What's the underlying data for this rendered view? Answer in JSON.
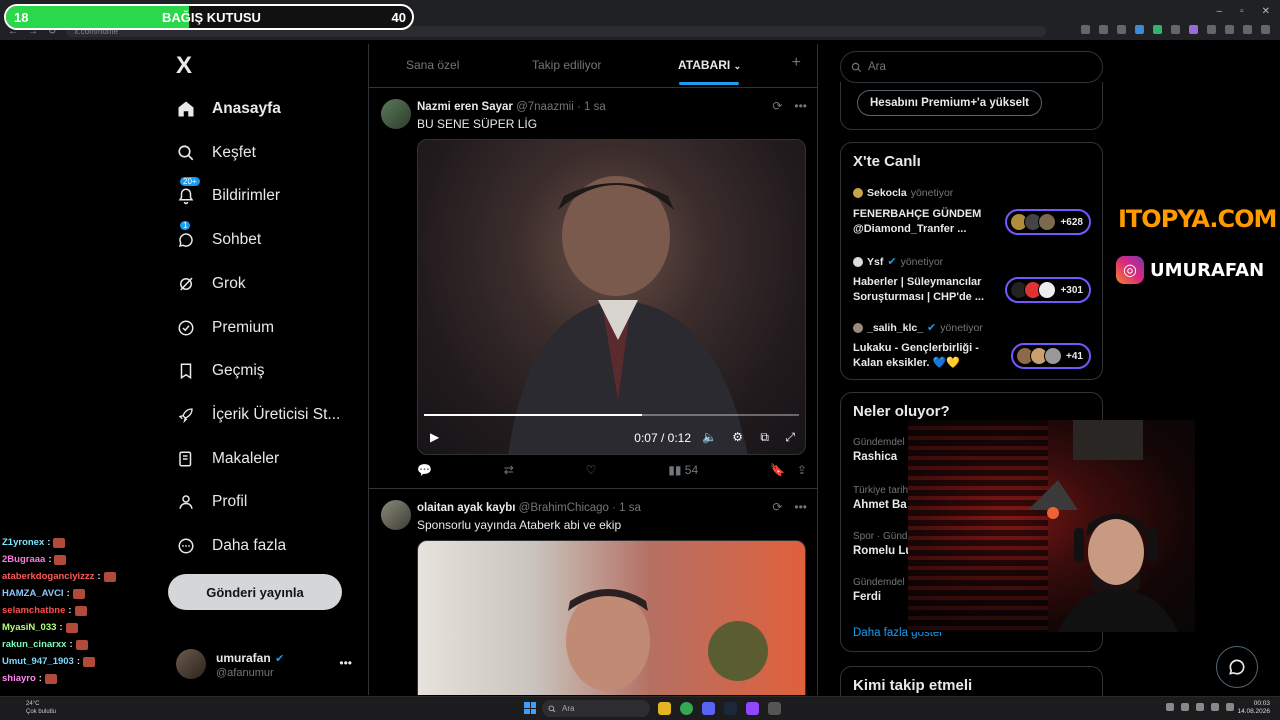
{
  "browser": {
    "url": "x.com/home"
  },
  "donation": {
    "left_value": "18",
    "label": "BAĞIŞ KUTUSU",
    "right_value": "40",
    "progress": 0.45,
    "color": "#2bd84b"
  },
  "sidebar": {
    "logo": "X",
    "items": [
      {
        "label": "Anasayfa",
        "icon": "home-icon"
      },
      {
        "label": "Keşfet",
        "icon": "search-icon"
      },
      {
        "label": "Bildirimler",
        "icon": "bell-icon",
        "badge": "20+"
      },
      {
        "label": "Sohbet",
        "icon": "chat-icon",
        "badge": "1"
      },
      {
        "label": "Grok",
        "icon": "grok-icon"
      },
      {
        "label": "Premium",
        "icon": "premium-icon"
      },
      {
        "label": "Geçmiş",
        "icon": "bookmark-icon"
      },
      {
        "label": "İçerik Üreticisi St...",
        "icon": "rocket-icon"
      },
      {
        "label": "Makaleler",
        "icon": "articles-icon"
      },
      {
        "label": "Profil",
        "icon": "profile-icon"
      },
      {
        "label": "Daha fazla",
        "icon": "more-icon"
      }
    ],
    "post_button": "Gönderi yayınla",
    "user": {
      "name": "umurafan",
      "handle": "@afanumur"
    }
  },
  "tabs": [
    {
      "label": "Sana özel"
    },
    {
      "label": "Takip ediliyor"
    },
    {
      "label": "ATABARI"
    }
  ],
  "tweets": [
    {
      "name": "Nazmi eren Sayar",
      "handle": "@7naazmii",
      "time": "· 1 sa",
      "text": "BU SENE SÜPER LİG",
      "video_time": "0:07 / 0:12",
      "progress": 0.58,
      "views": "54"
    },
    {
      "name": "olaitan ayak kaybı",
      "handle": "@BrahimChicago",
      "time": "· 1 sa",
      "text": "Sponsorlu yayında Ataberk abi ve ekip"
    }
  ],
  "right": {
    "search_placeholder": "Ara",
    "premium_button": "Hesabını Premium+'a yükselt",
    "live_title": "X'te Canlı",
    "live_items": [
      {
        "host": "Sekocla",
        "role": "yönetiyor",
        "title": "FENERBAHÇE GÜNDEM @Diamond_Tranfer ...",
        "count": "+628"
      },
      {
        "host": "Ysf",
        "role": "yönetiyor",
        "title": "Haberler | Süleymancılar Soruşturması | CHP'de ...",
        "count": "+301"
      },
      {
        "host": "_salih_klc_",
        "role": "yönetiyor",
        "title": "Lukaku - Gençlerbirliği - Kalan eksikler. 💙💛",
        "count": "+41"
      }
    ],
    "trends_title": "Neler oluyor?",
    "trends": [
      {
        "category": "Gündemdel",
        "name": "Rashica"
      },
      {
        "category": "Türkiye tarih",
        "name": "Ahmet Ba"
      },
      {
        "category": "Spor · Günd",
        "name": "Romelu Lu"
      },
      {
        "category": "Gündemdel",
        "name": "Ferdi"
      }
    ],
    "more_link": "Daha fazla göster",
    "follow_title": "Kimi takip etmeli"
  },
  "branding": {
    "sponsor": "ITOPYA.COM",
    "instagram": "UMURAFAN"
  },
  "chat": [
    {
      "user": "Z1yronex",
      "color": "#7de3ff"
    },
    {
      "user": "2Bugraaa",
      "color": "#ff7be0"
    },
    {
      "user": "ataberkdoganciyizzz",
      "color": "#ff5a5a"
    },
    {
      "user": "HAMZA_AVCI",
      "color": "#8ec7ff"
    },
    {
      "user": "selamchatbne",
      "color": "#ff4d4d"
    },
    {
      "user": "MyasiN_033",
      "color": "#b8ff7a"
    },
    {
      "user": "rakun_cinarxx",
      "color": "#7affc0"
    },
    {
      "user": "Umut_947_1903",
      "color": "#7fd8ff"
    },
    {
      "user": "shiayro",
      "color": "#ff8bf0"
    }
  ],
  "taskbar": {
    "weather_temp": "24°C",
    "weather_desc": "Çok bulutlu",
    "search": "Ara",
    "time": "00:03",
    "date": "14.08.2026"
  }
}
